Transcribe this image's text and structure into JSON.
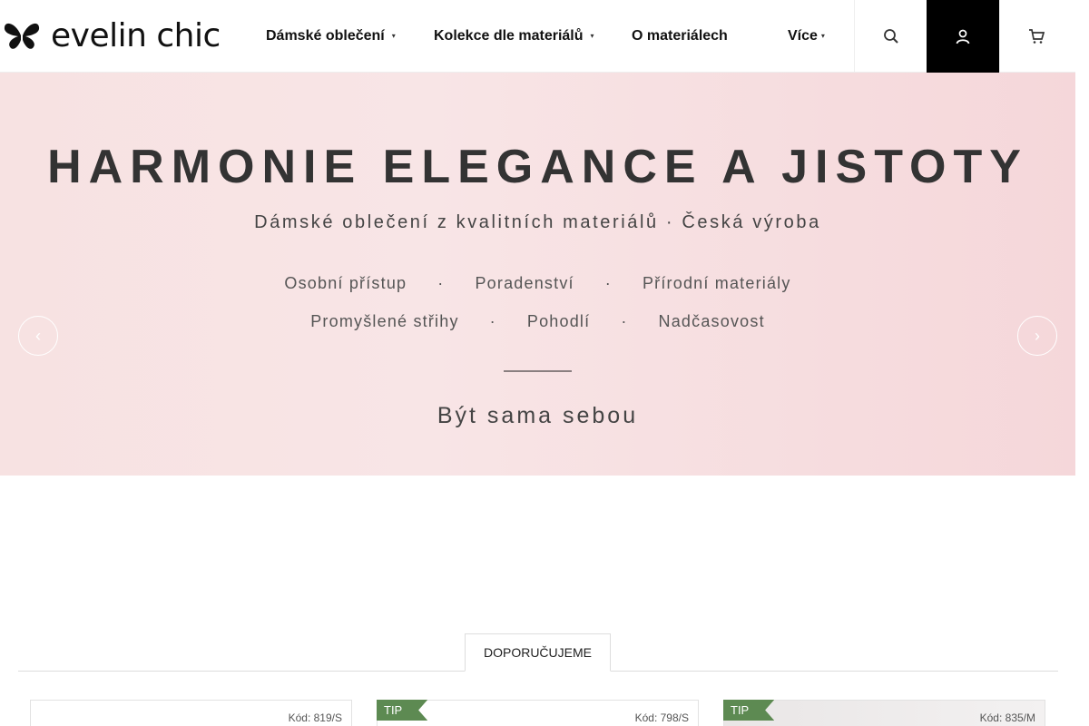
{
  "brand": {
    "name": "evelin chic"
  },
  "nav": {
    "items": [
      {
        "label": "Dámské oblečení",
        "has_dropdown": true
      },
      {
        "label": "Kolekce dle materiálů",
        "has_dropdown": true
      },
      {
        "label": "O materiálech",
        "has_dropdown": false
      },
      {
        "label": "Více",
        "has_dropdown": true
      }
    ],
    "caret": "▾"
  },
  "header_buttons": [
    {
      "icon": "search-icon"
    },
    {
      "icon": "user-icon"
    },
    {
      "icon": "cart-icon"
    }
  ],
  "hero": {
    "title": "HARMONIE ELEGANCE A JISTOTY",
    "subtitle": "Dámské oblečení z kvalitních materiálů · Česká výroba",
    "row1": [
      "Osobní přístup",
      "Poradenství",
      "Přírodní materiály"
    ],
    "row2": [
      "Promyšlené střihy",
      "Pohodlí",
      "Nadčasovost"
    ],
    "separator": "·",
    "tagline": "Být sama sebou",
    "prev_arrow": "‹",
    "next_arrow": "›"
  },
  "tabs": [
    {
      "label": "DOPORUČUJEME",
      "active": true
    }
  ],
  "products": [
    {
      "code": "Kód: 819/S",
      "tip": ""
    },
    {
      "code": "Kód: 798/S",
      "tip": "TIP"
    },
    {
      "code": "Kód: 835/M",
      "tip": "TIP"
    }
  ],
  "colors": {
    "hero_bg": "#f7e2e2",
    "tip_badge": "#5d8a52",
    "dark_button": "#000000"
  }
}
